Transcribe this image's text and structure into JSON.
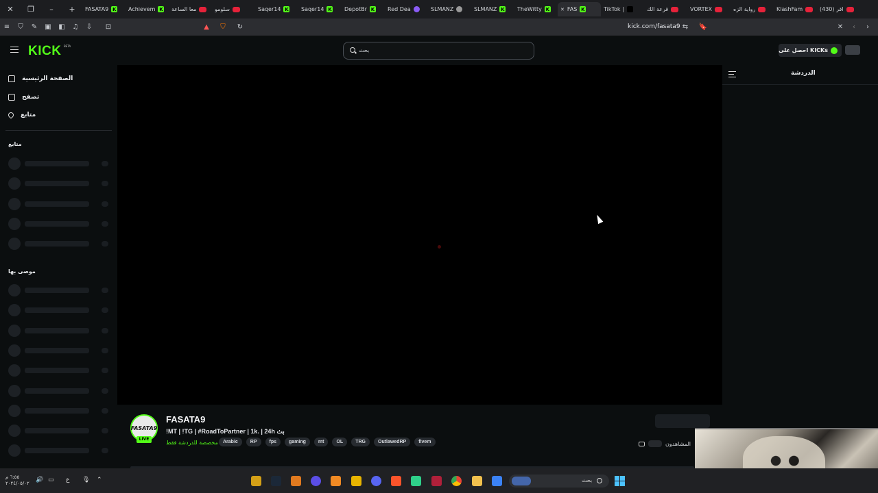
{
  "browser": {
    "tabs": [
      {
        "title": "FASATA9",
        "favicon": "kick-icon",
        "active": false
      },
      {
        "title": "Achievem",
        "favicon": "kick-icon",
        "active": false
      },
      {
        "title": "معا الساعة",
        "favicon": "youtube-icon",
        "active": false
      },
      {
        "title": "سلومو",
        "favicon": "youtube-icon",
        "active": false
      },
      {
        "title": "Saqer14",
        "favicon": "kick-icon",
        "active": false
      },
      {
        "title": "Saqer14",
        "favicon": "kick-icon",
        "active": false
      },
      {
        "title": "DepotBr",
        "favicon": "kick-icon",
        "active": false
      },
      {
        "title": "Red Dea",
        "favicon": "purple-icon",
        "active": false
      },
      {
        "title": "SLMANZ",
        "favicon": "globe-icon",
        "active": false
      },
      {
        "title": "SLMANZ",
        "favicon": "kick-icon",
        "active": false
      },
      {
        "title": "TheWitty",
        "favicon": "kick-icon",
        "active": false
      },
      {
        "title": "FAS",
        "favicon": "kick-icon",
        "active": true
      },
      {
        "title": "TikTok |",
        "favicon": "tiktok-icon",
        "active": false
      },
      {
        "title": "قرعة الك",
        "favicon": "youtube-icon",
        "active": false
      },
      {
        "title": "VORTEX",
        "favicon": "youtube-icon",
        "active": false
      },
      {
        "title": "رواية الزه",
        "favicon": "youtube-icon",
        "active": false
      },
      {
        "title": "KlashFam",
        "favicon": "youtube-icon",
        "active": false
      },
      {
        "title": "(430) اقر",
        "favicon": "youtube-icon",
        "active": false
      }
    ],
    "url": "kick.com/fasata9",
    "shield_count": "2",
    "alert_count": "3"
  },
  "header": {
    "logo": "KICK",
    "beta": "BETA",
    "search_placeholder": "بحث",
    "get_kicks": "احصل على KICKs"
  },
  "sidebar": {
    "nav": [
      {
        "label": "الصفحة الرئيسية",
        "icon": "home-icon"
      },
      {
        "label": "تصفح",
        "icon": "browse-icon"
      },
      {
        "label": "متابع",
        "icon": "heart-icon"
      }
    ],
    "following_title": "متابع",
    "recommended_title": "موصى بها"
  },
  "chat": {
    "title": "الدردشة"
  },
  "stream": {
    "channel_name": "FASATA9",
    "avatar_text": "FASATA9",
    "live": "LIVE",
    "title": "!MT | !TG | #RoadToPartner | 1k. | 24h بث",
    "category": "مخصصة للدردشة فقط",
    "tags": [
      "Arabic",
      "RP",
      "fps",
      "gaming",
      "mt",
      "OL",
      "TRG",
      "OutlawedRP",
      "fivem"
    ],
    "viewers_label": "المشاهدون"
  },
  "taskbar": {
    "time": "٦:٥٥ م",
    "date": "٢٠٢٤/٠٥/٠٢",
    "lang": "ع",
    "search_placeholder": "بحث"
  },
  "colors": {
    "brand": "#53fc18",
    "background": "#0b0e0f"
  }
}
